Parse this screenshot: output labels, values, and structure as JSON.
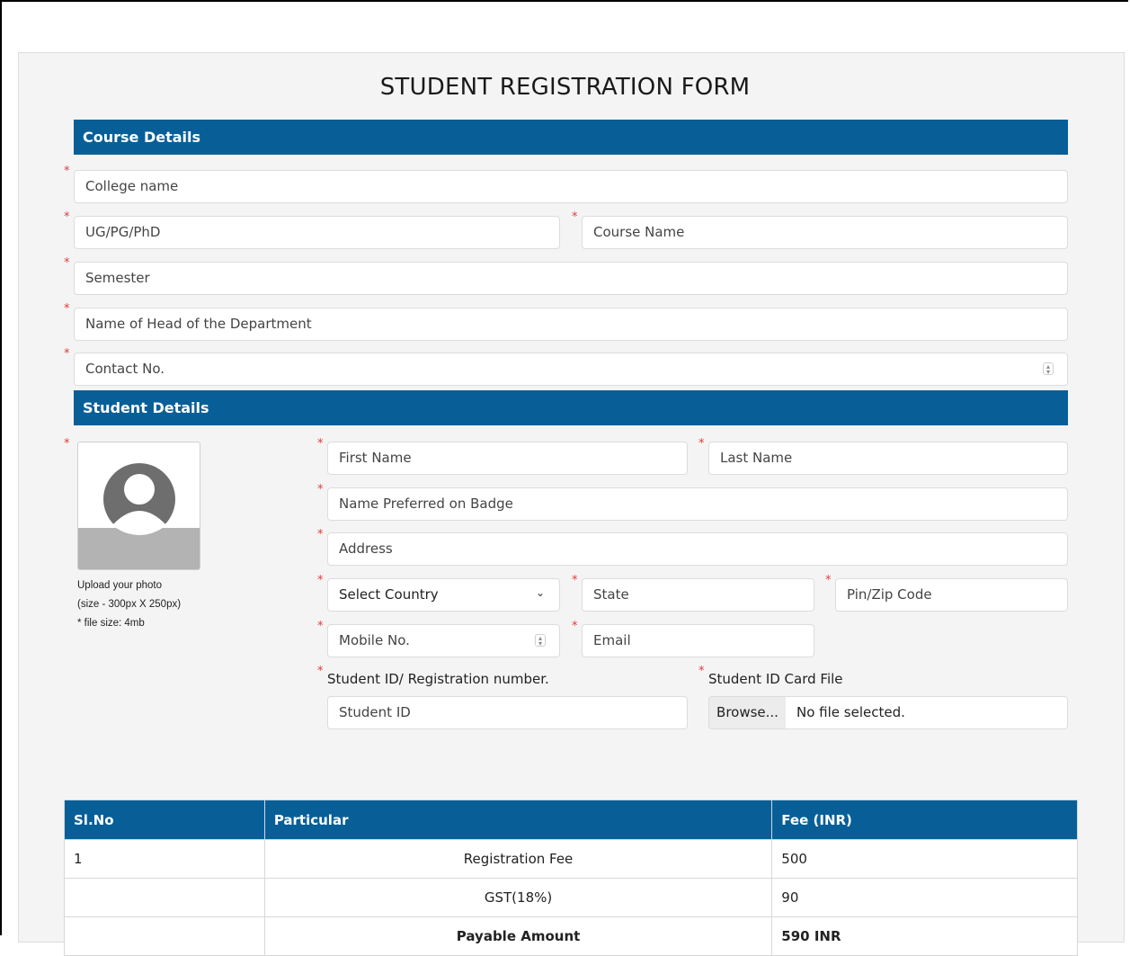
{
  "title": "STUDENT REGISTRATION FORM",
  "colors": {
    "header_bg": "#085f97",
    "required": "#e23b3b",
    "panel_bg": "#f4f4f4"
  },
  "course_section": {
    "header": "Course Details",
    "college_name_placeholder": "College name",
    "level_placeholder": "UG/PG/PhD",
    "course_name_placeholder": "Course Name",
    "semester_placeholder": "Semester",
    "hod_placeholder": "Name of Head of the Department",
    "contact_placeholder": "Contact No."
  },
  "student_section": {
    "header": "Student Details",
    "photo_caption": [
      "Upload your photo",
      "(size - 300px X 250px)",
      "* file size: 4mb"
    ],
    "first_name_placeholder": "First Name",
    "last_name_placeholder": "Last Name",
    "badge_name_placeholder": "Name Preferred on Badge",
    "address_placeholder": "Address",
    "country_selected": "Select Country",
    "state_placeholder": "State",
    "pin_placeholder": "Pin/Zip Code",
    "mobile_placeholder": "Mobile No.",
    "email_placeholder": "Email",
    "student_id_label": "Student ID/ Registration number.",
    "student_id_placeholder": "Student ID",
    "id_card_label": "Student ID Card File",
    "browse_label": "Browse...",
    "file_status": "No file selected."
  },
  "fee_table": {
    "headers": [
      "Sl.No",
      "Particular",
      "Fee (INR)"
    ],
    "rows": [
      [
        "1",
        "Registration Fee",
        "500"
      ],
      [
        "",
        "GST(18%)",
        "90"
      ],
      [
        "",
        "Payable Amount",
        "590 INR"
      ]
    ]
  },
  "icons": {
    "required": "*",
    "spinner": "⇕",
    "dropdown": "chevron-down",
    "avatar": "user-avatar-icon"
  }
}
